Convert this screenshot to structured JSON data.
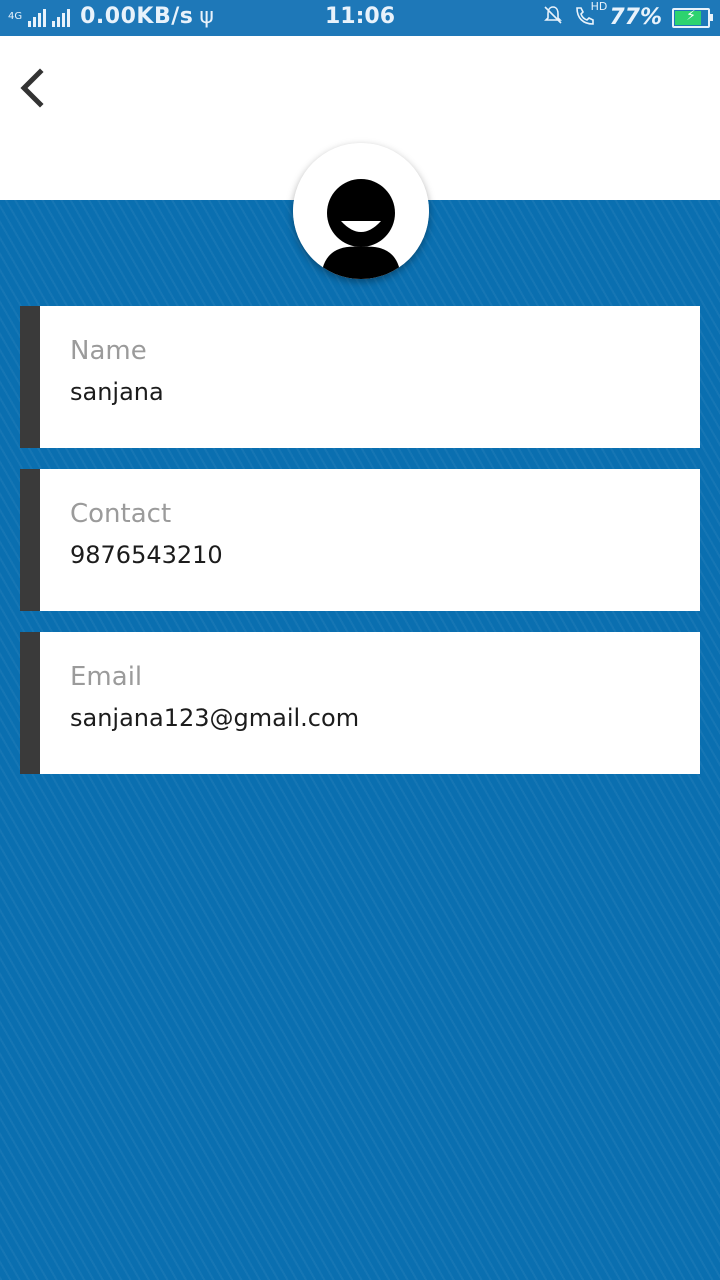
{
  "status_bar": {
    "network": "4G",
    "speed": "0.00KB/s",
    "time": "11:06",
    "volte": "HD",
    "battery_percent": "77%",
    "battery_level": 0.77
  },
  "header": {
    "back_icon": "chevron-left-icon"
  },
  "avatar": {
    "icon": "user-avatar-icon"
  },
  "fields": [
    {
      "label": "Name",
      "value": "sanjana"
    },
    {
      "label": "Contact",
      "value": "9876543210"
    },
    {
      "label": "Email",
      "value": "sanjana123@gmail.com"
    }
  ],
  "colors": {
    "status_bar": "#1e78b8",
    "background_blue": "#0a6fb0",
    "accent_bar": "#3a3a3a",
    "label": "#9b9b9b",
    "value": "#1c1c1c"
  }
}
